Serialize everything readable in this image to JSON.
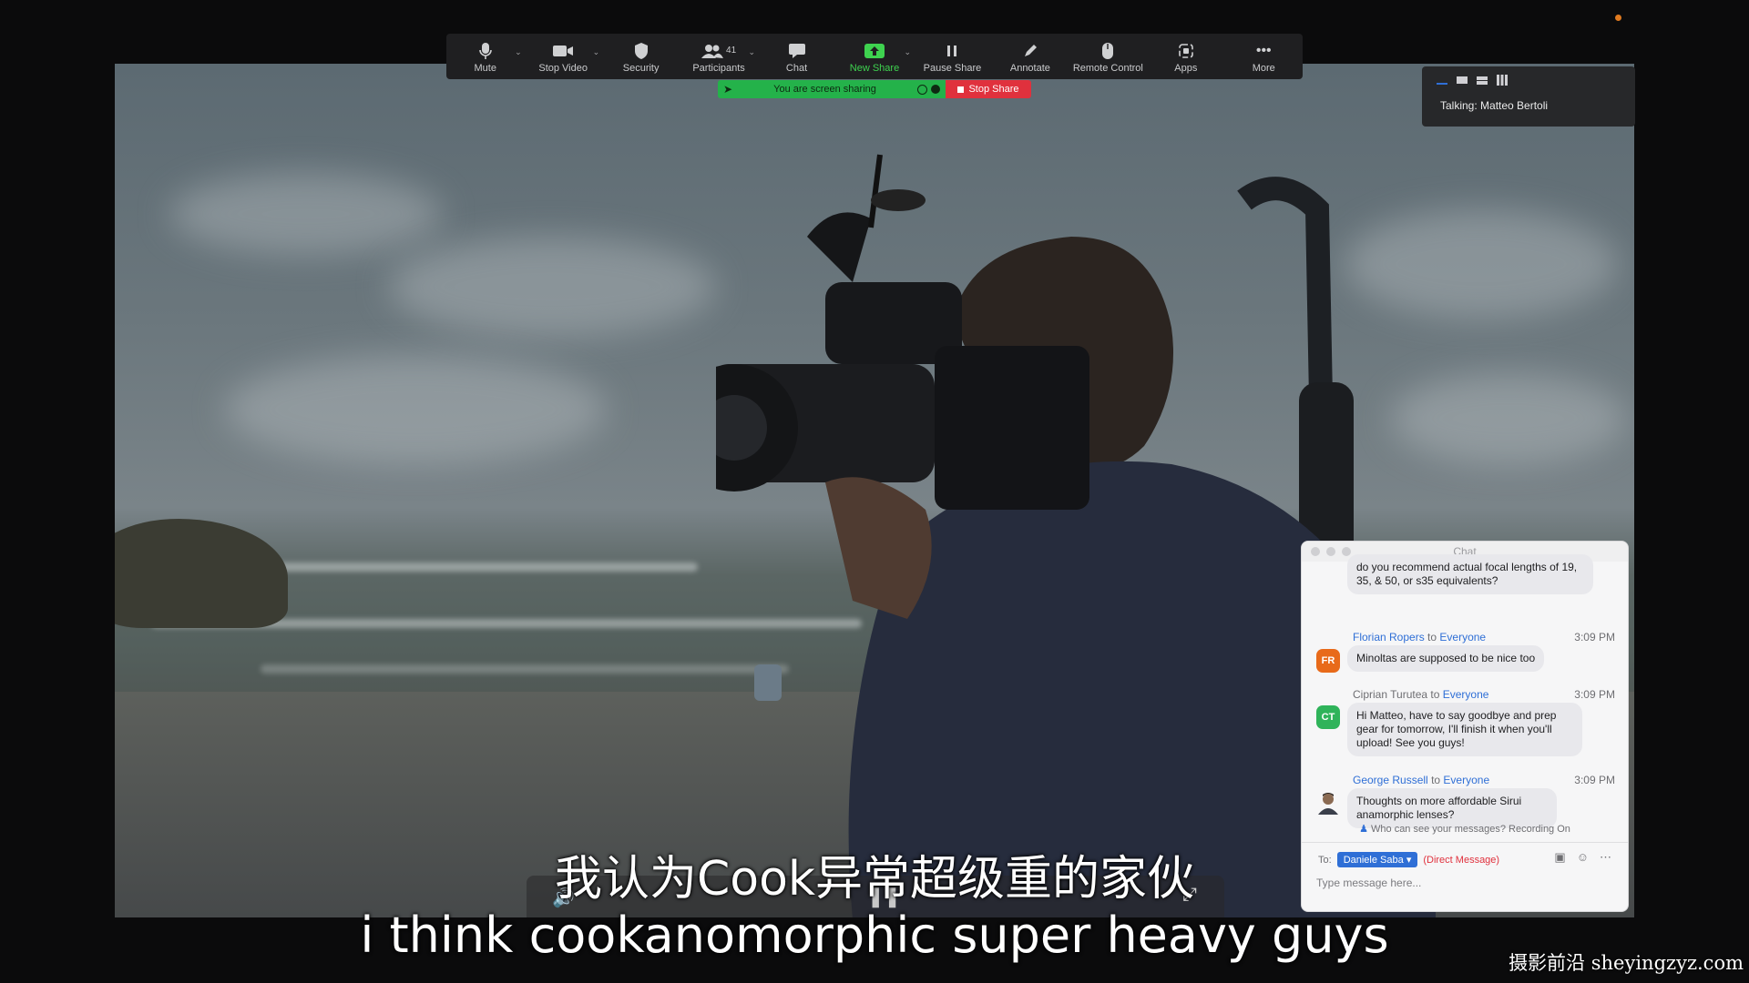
{
  "toolbar": {
    "mute": "Mute",
    "stop_video": "Stop Video",
    "security": "Security",
    "participants": "Participants",
    "participants_count": "41",
    "chat": "Chat",
    "new_share": "New Share",
    "pause_share": "Pause Share",
    "annotate": "Annotate",
    "remote_control": "Remote Control",
    "apps": "Apps",
    "more": "More"
  },
  "share_bar": {
    "status": "You are screen sharing",
    "stop": "Stop Share"
  },
  "view_panel": {
    "talking": "Talking: Matteo Bertoli"
  },
  "chat": {
    "title": "Chat",
    "partial_message": "do you recommend actual focal lengths of 19, 35, & 50, or s35 equivalents?",
    "messages": [
      {
        "sender": "Florian Ropers",
        "to": "to",
        "audience": "Everyone",
        "time": "3:09 PM",
        "initials": "FR",
        "text": "Minoltas are supposed to be nice too",
        "avatar_color": "#e86a1a"
      },
      {
        "sender": "Ciprian Turutea",
        "to": "to",
        "audience": "Everyone",
        "time": "3:09 PM",
        "initials": "CT",
        "text": "Hi Matteo, have to say goodbye and prep gear for tomorrow, I'll finish it when you'll upload! See you guys!",
        "avatar_color": "#2fb35a"
      },
      {
        "sender": "George Russell",
        "to": "to",
        "audience": "Everyone",
        "time": "3:09 PM",
        "initials": "",
        "text": "Thoughts on more affordable Sirui anamorphic lenses?",
        "avatar_color": "#8a6a52"
      }
    ],
    "notice": "Who can see your messages? Recording On",
    "to_label": "To:",
    "recipient": "Daniele Saba",
    "direct": "(Direct Message)",
    "input_placeholder": "Type message here..."
  },
  "subtitles": {
    "cn": "我认为Cook异常超级重的家伙",
    "en": "i think cookanomorphic super heavy guys"
  },
  "watermark": "摄影前沿 sheyingzyz.com",
  "colors": {
    "accent_green": "#3ed24f",
    "stop_red": "#e0313d",
    "link_blue": "#2f6fd6"
  }
}
